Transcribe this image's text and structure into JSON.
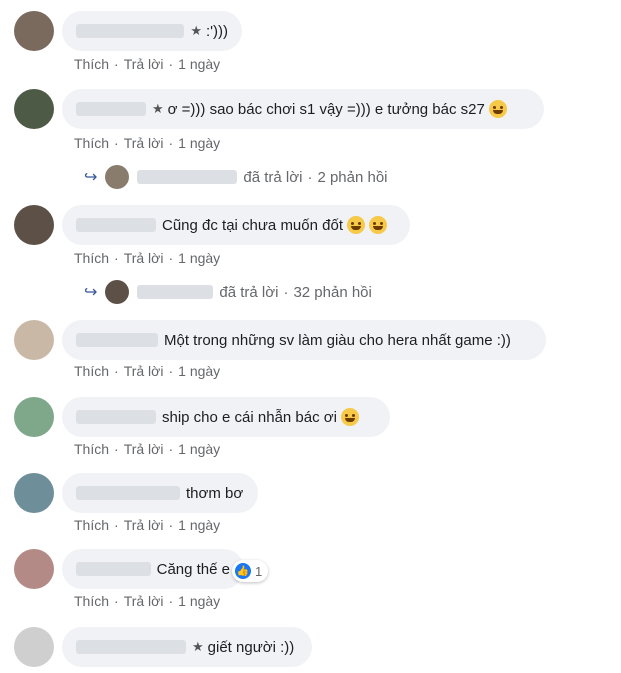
{
  "labels": {
    "like": "Thích",
    "reply": "Trả lời",
    "dot": "·",
    "replied": "đã trả lời"
  },
  "comments": [
    {
      "text": ":')))",
      "time": "1 ngày",
      "avatar_color": "#7a6a5e"
    },
    {
      "text": "ơ =))) sao bác chơi s1 vậy =))) e tưởng bác s27",
      "time": "1 ngày",
      "avatar_color": "#4d5a45"
    },
    {
      "text": "Cũng đc tại chưa muốn đốt",
      "time": "1 ngày",
      "avatar_color": "#5d5046"
    },
    {
      "text": "Một trong những sv làm giàu cho hera nhất game :))",
      "time": "1 ngày",
      "avatar_color": "#c9b8a6"
    },
    {
      "text": "ship cho e cái nhẫn bác ơi",
      "time": "1 ngày",
      "avatar_color": "#7fa88a"
    },
    {
      "text": "thơm bơ",
      "time": "1 ngày",
      "avatar_color": "#6e8f9a"
    },
    {
      "text": "Căng thế e",
      "time": "1 ngày",
      "avatar_color": "#b48a86",
      "reaction_count": "1"
    },
    {
      "text": "giết người :))",
      "time": "",
      "avatar_color": "#cfcfcf"
    }
  ],
  "replies": [
    {
      "count_text": "2 phản hồi"
    },
    {
      "count_text": "32 phản hồi"
    }
  ]
}
